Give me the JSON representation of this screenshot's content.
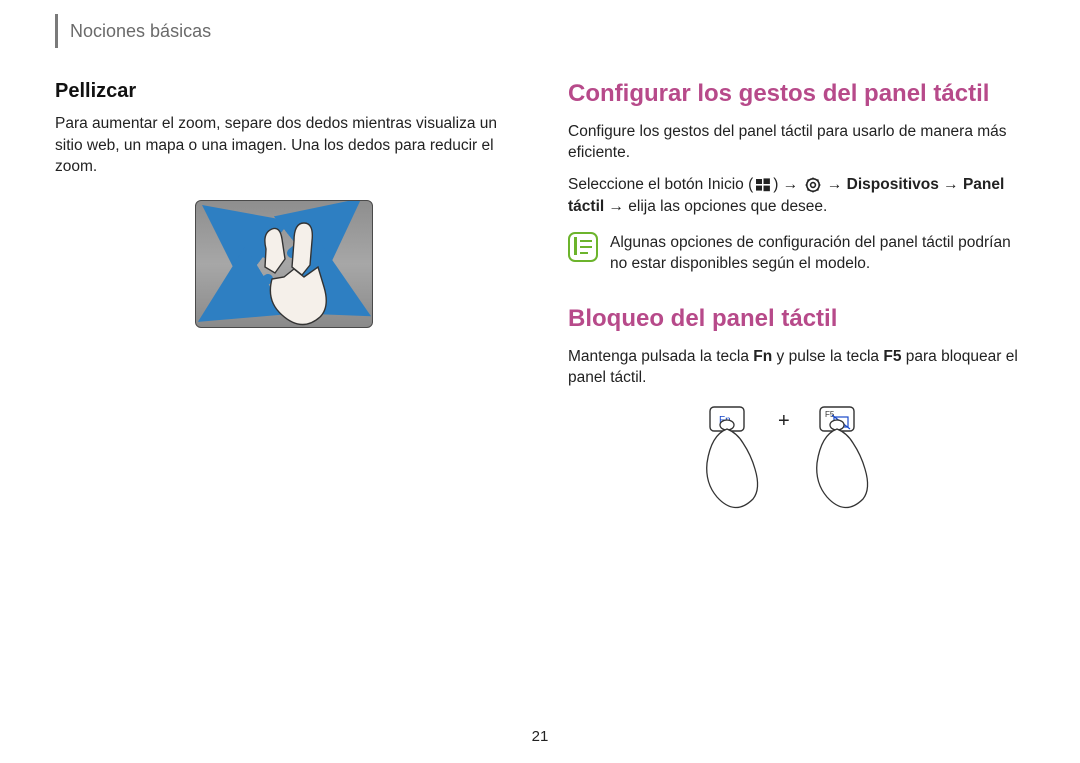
{
  "header": {
    "section": "Nociones básicas"
  },
  "left": {
    "pellizcar_title": "Pellizcar",
    "pellizcar_body": "Para aumentar el zoom, separe dos dedos mientras visualiza un sitio web, un mapa o una imagen. Una los dedos para reducir el zoom."
  },
  "right": {
    "configurar_title": "Configurar los gestos del panel táctil",
    "configurar_body": "Configure los gestos del panel táctil para usarlo de manera más eficiente.",
    "path_pre": "Seleccione el botón Inicio (",
    "path_arrow1": ") → ",
    "path_arrow2": " → ",
    "path_devices": "Dispositivos",
    "path_arrow3": " → ",
    "path_touchpad": "Panel táctil",
    "path_post": " → elija las opciones que desee.",
    "note": "Algunas opciones de configuración del panel táctil podrían no estar disponibles según el modelo.",
    "bloqueo_title": "Bloqueo del panel táctil",
    "bloqueo_body_1": "Mantenga pulsada la tecla ",
    "bloqueo_fn": "Fn",
    "bloqueo_body_2": " y pulse la tecla ",
    "bloqueo_f5": "F5",
    "bloqueo_body_3": " para bloquear el panel táctil.",
    "key_fn_label": "Fn",
    "key_f5_label": "F5",
    "plus": "+"
  },
  "page_number": "21"
}
